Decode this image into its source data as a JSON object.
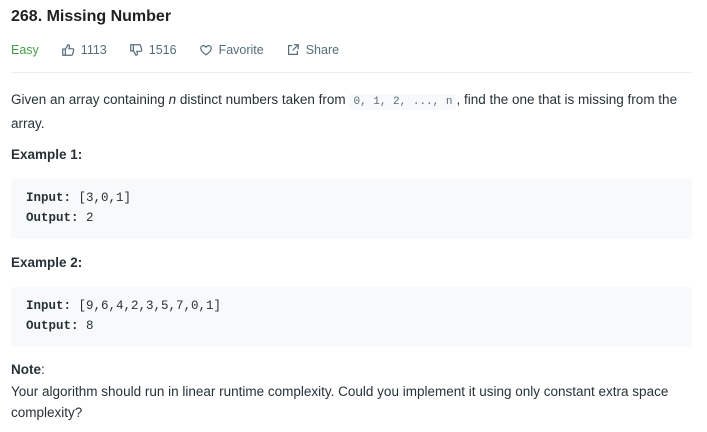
{
  "problem": {
    "title": "268. Missing Number",
    "difficulty": "Easy",
    "likes": "1113",
    "dislikes": "1516",
    "favorite_label": "Favorite",
    "share_label": "Share"
  },
  "description": {
    "text_before": "Given an array containing ",
    "n_var": "n",
    "text_middle": " distinct numbers taken from ",
    "range_code": "0, 1, 2, ..., n",
    "text_after": ", find the one that is missing from the array."
  },
  "examples": [
    {
      "title": "Example 1:",
      "input_label": "Input:",
      "input_value": " [3,0,1]",
      "output_label": "Output:",
      "output_value": " 2"
    },
    {
      "title": "Example 2:",
      "input_label": "Input:",
      "input_value": " [9,6,4,2,3,5,7,0,1]",
      "output_label": "Output:",
      "output_value": " 8"
    }
  ],
  "note": {
    "label": "Note",
    "colon": ":",
    "text": "Your algorithm should run in linear runtime complexity. Could you implement it using only constant extra space complexity?"
  }
}
